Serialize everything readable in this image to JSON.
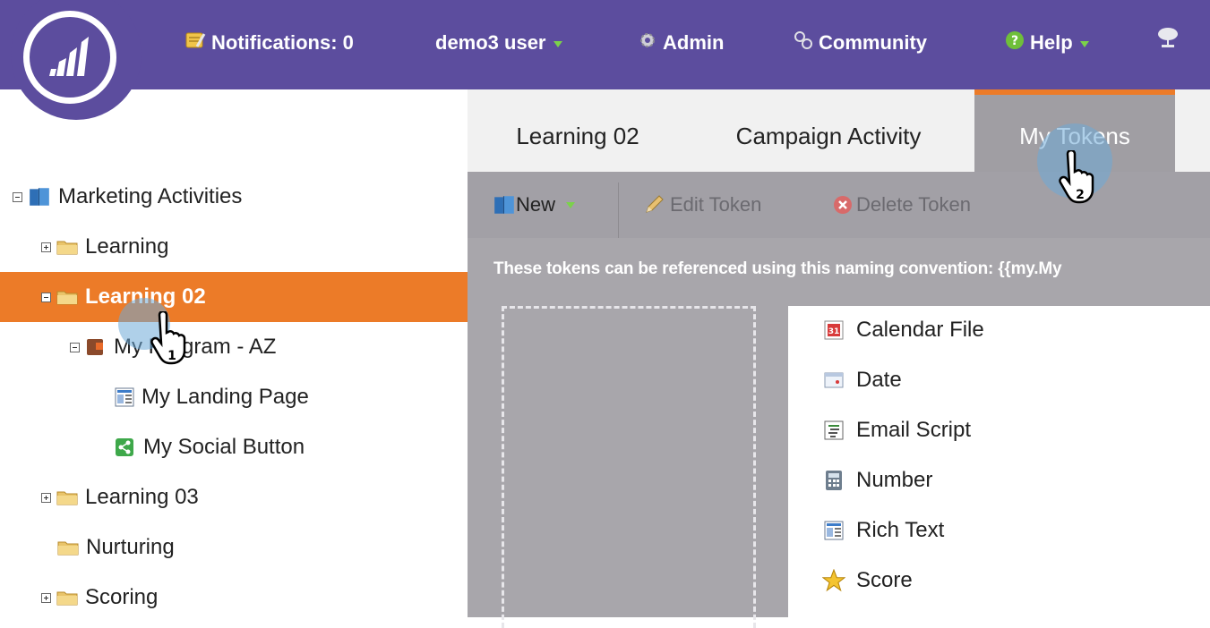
{
  "topbar": {
    "notifications": "Notifications: 0",
    "user": "demo3 user",
    "admin": "Admin",
    "community": "Community",
    "help": "Help"
  },
  "tree": {
    "items": [
      {
        "label": "Marketing Activities"
      },
      {
        "label": "Learning"
      },
      {
        "label": "Learning 02"
      },
      {
        "label": "My Program - AZ"
      },
      {
        "label": "My Landing Page"
      },
      {
        "label": "My Social Button"
      },
      {
        "label": "Learning 03"
      },
      {
        "label": "Nurturing"
      },
      {
        "label": "Scoring"
      }
    ]
  },
  "tabs": [
    {
      "label": "Learning 02"
    },
    {
      "label": "Campaign Activity"
    },
    {
      "label": "My Tokens"
    }
  ],
  "toolbar": {
    "new": "New",
    "edit": "Edit Token",
    "delete": "Delete Token"
  },
  "hint": "These tokens can be referenced using this naming convention: {{my.My",
  "tokens": [
    {
      "label": "Calendar File",
      "icon": "calendar-file-icon"
    },
    {
      "label": "Date",
      "icon": "date-icon"
    },
    {
      "label": "Email Script",
      "icon": "email-script-icon"
    },
    {
      "label": "Number",
      "icon": "number-icon"
    },
    {
      "label": "Rich Text",
      "icon": "rich-text-icon"
    },
    {
      "label": "Score",
      "icon": "star-icon"
    }
  ],
  "callouts": {
    "step1": "1",
    "step2": "2"
  },
  "colors": {
    "header": "#5c4d9e",
    "selected": "#ec7b28",
    "toolbar": "#a2a0a6"
  }
}
